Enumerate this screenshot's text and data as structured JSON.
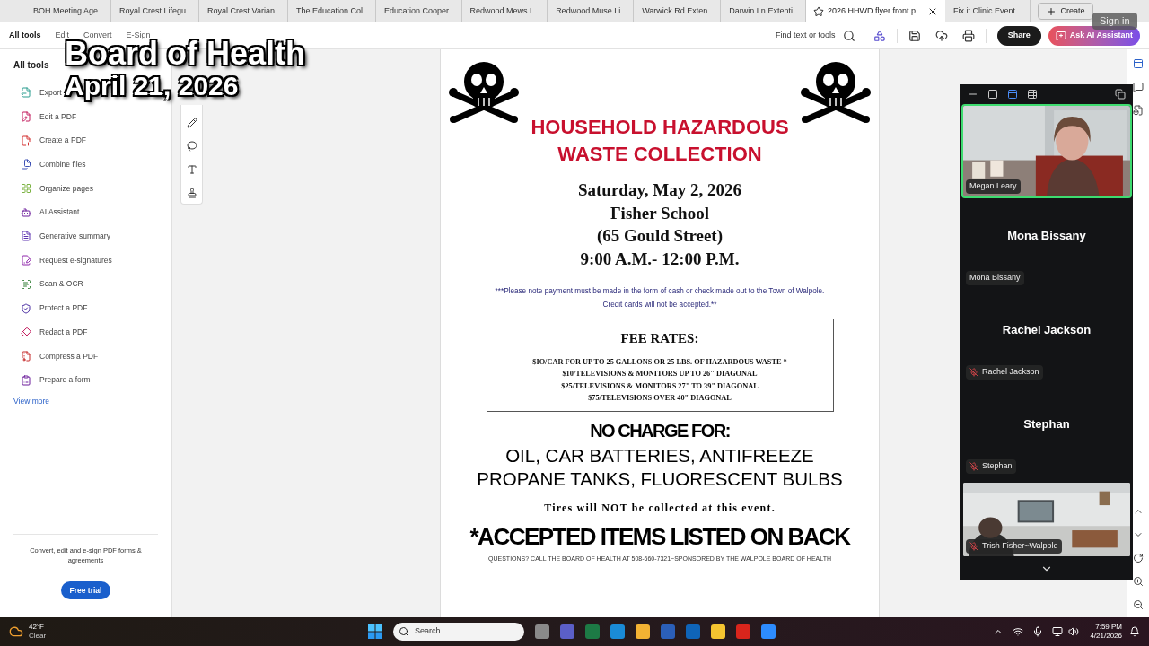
{
  "browser_tabs": [
    {
      "label": "BOH Meeting Age..",
      "selected": false
    },
    {
      "label": "Royal Crest Lifegu..",
      "selected": false
    },
    {
      "label": "Royal Crest Varian..",
      "selected": false
    },
    {
      "label": "The Education Col..",
      "selected": false
    },
    {
      "label": "Education Cooper..",
      "selected": false
    },
    {
      "label": "Redwood Mews L..",
      "selected": false
    },
    {
      "label": "Redwood Muse Li..",
      "selected": false
    },
    {
      "label": "Warwick Rd Exten..",
      "selected": false
    },
    {
      "label": "Darwin Ln Extenti..",
      "selected": false
    },
    {
      "label": "2026 HHWD flyer front p..",
      "selected": true
    },
    {
      "label": "Fix it Clinic Event ..",
      "selected": false
    }
  ],
  "create_button": "Create",
  "tooltip": "Sign in",
  "menu": [
    {
      "label": "All tools",
      "selected": true
    },
    {
      "label": "Edit",
      "selected": false
    },
    {
      "label": "Convert",
      "selected": false
    },
    {
      "label": "E-Sign",
      "selected": false
    }
  ],
  "find_label": "Find text or tools",
  "share_button": "Share",
  "ai_button": "Ask AI Assistant",
  "sidebar": {
    "title": "All tools",
    "items": [
      "Export",
      "Edit a PDF",
      "Create a PDF",
      "Combine files",
      "Organize pages",
      "AI Assistant",
      "Generative summary",
      "Request e-signatures",
      "Scan & OCR",
      "Protect a PDF",
      "Redact a PDF",
      "Compress a PDF",
      "Prepare a form"
    ],
    "view_more": "View more",
    "promo": "Convert, edit and e-sign PDF forms & agreements",
    "trial_button": "Free trial"
  },
  "overlay": {
    "title": "Board of Health",
    "date": "April 21, 2026"
  },
  "flyer": {
    "title": "HOUSEHOLD HAZARDOUS WASTE COLLECTION",
    "event_lines": [
      "Saturday, May 2, 2026",
      "Fisher School",
      "(65 Gould Street)",
      "9:00 A.M.- 12:00 P.M."
    ],
    "note_lines": [
      "***Please note payment must be made in the form of cash or check made out to the Town of Walpole.",
      "Credit cards will not be accepted.**"
    ],
    "fee_heading": "FEE RATES:",
    "fees": [
      "$IO/CAR FOR UP TO 25 GALLONS OR 25 LBS. OF HAZARDOUS WASTE *",
      "$10/TELEVISIONS & MONITORS UP TO 26\" DIAGONAL",
      "$25/TELEVISIONS & MONITORS 27\" TO 39\" DIAGONAL",
      "$75/TELEVISIONS OVER 40\" DIAGONAL"
    ],
    "no_charge_heading": "NO CHARGE FOR:",
    "no_charge_lines": [
      "OIL, CAR BATTERIES, ANTIFREEZE",
      "PROPANE TANKS, FLUORESCENT BULBS"
    ],
    "tires_note": "Tires will NOT be collected at this event.",
    "accepted_note": "*ACCEPTED ITEMS LISTED ON BACK",
    "footer": "QUESTIONS? CALL THE BOARD OF HEALTH AT 508-660-7321~SPONSORED BY THE WALPOLE BOARD OF HEALTH"
  },
  "meeting": {
    "participants": [
      {
        "name": "Megan Leary",
        "kind": "video",
        "muted": false,
        "selected": true
      },
      {
        "name": "Mona Bissany",
        "tile_name": "Mona Bissany",
        "kind": "name",
        "muted": false,
        "selected": false
      },
      {
        "name": "Rachel Jackson",
        "tile_name": "Rachel Jackson",
        "kind": "name",
        "muted": true,
        "selected": false
      },
      {
        "name": "Stephan",
        "tile_name": "Stephan",
        "kind": "name",
        "muted": true,
        "selected": false
      },
      {
        "name": "Trish Fisher~Walpole",
        "kind": "video",
        "muted": true,
        "selected": false
      }
    ]
  },
  "taskbar": {
    "temperature": "42°F",
    "weather": "Clear",
    "search_placeholder": "Search",
    "time": "7:59 PM",
    "date": "4/21/2026"
  }
}
